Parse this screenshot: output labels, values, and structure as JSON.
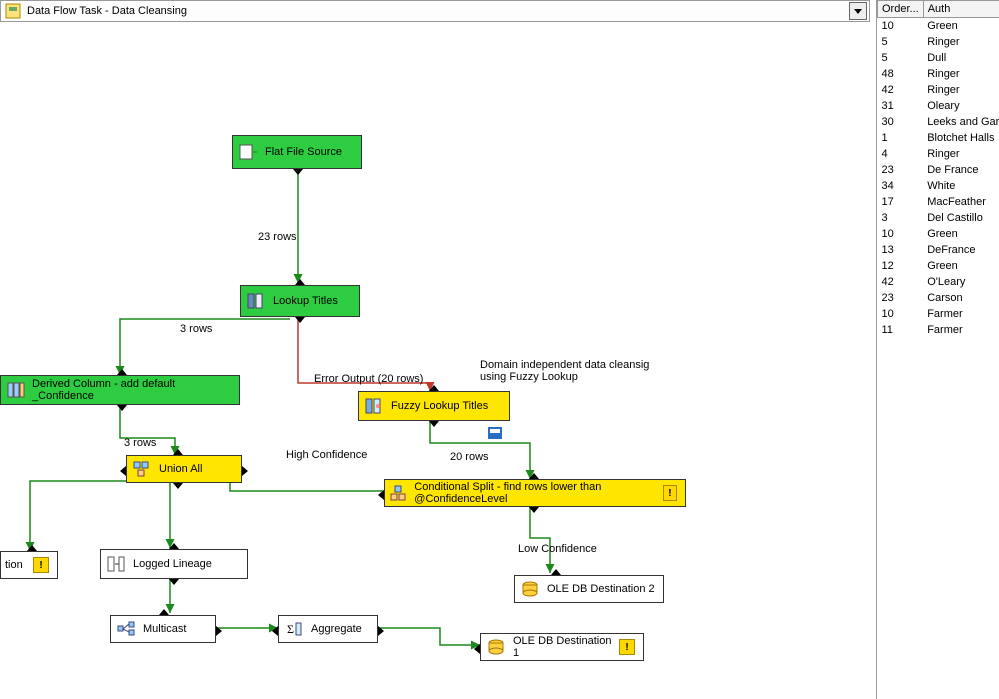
{
  "titlebar": {
    "label": "Data Flow Task - Data Cleansing"
  },
  "nodes": {
    "flat_file_source": "Flat File Source",
    "lookup_titles": "Lookup Titles",
    "derived_column": "Derived Column - add default _Confidence",
    "fuzzy_lookup": "Fuzzy Lookup Titles",
    "union_all": "Union All",
    "conditional_split": "Conditional Split - find rows lower than @ConfidenceLevel",
    "ole_db_dest_truncated": "tion",
    "logged_lineage": "Logged Lineage",
    "ole_db_destination_2": "OLE DB Destination 2",
    "multicast": "Multicast",
    "aggregate": "Aggregate",
    "ole_db_destination_1": "OLE DB Destination 1"
  },
  "flow_labels": {
    "rows_23": "23 rows",
    "rows_3_a": "3 rows",
    "rows_3_b": "3 rows",
    "error_output": "Error Output (20 rows)",
    "fuzzy_note": "Domain independent data cleansig using Fuzzy Lookup",
    "high_conf": "High Confidence",
    "rows_20": "20 rows",
    "low_conf": "Low Confidence"
  },
  "side_table": {
    "headers": [
      "Order...",
      "Auth"
    ],
    "rows": [
      [
        "10",
        "Green"
      ],
      [
        "5",
        "Ringer"
      ],
      [
        "5",
        "Dull"
      ],
      [
        "48",
        "Ringer"
      ],
      [
        "42",
        "Ringer"
      ],
      [
        "31",
        "Oleary"
      ],
      [
        "30",
        " Leeks and Garlic"
      ],
      [
        "1",
        "Blotchet Halls"
      ],
      [
        "4",
        "Ringer"
      ],
      [
        "23",
        "De France"
      ],
      [
        "34",
        "White"
      ],
      [
        "17",
        "MacFeather"
      ],
      [
        "3",
        "Del Castillo"
      ],
      [
        "10",
        "Green"
      ],
      [
        "13",
        "DeFrance"
      ],
      [
        "12",
        "Green"
      ],
      [
        "42",
        "O'Leary"
      ],
      [
        "23",
        "Carson"
      ],
      [
        "10",
        "Farmer"
      ],
      [
        "11",
        "Farmer"
      ]
    ]
  }
}
